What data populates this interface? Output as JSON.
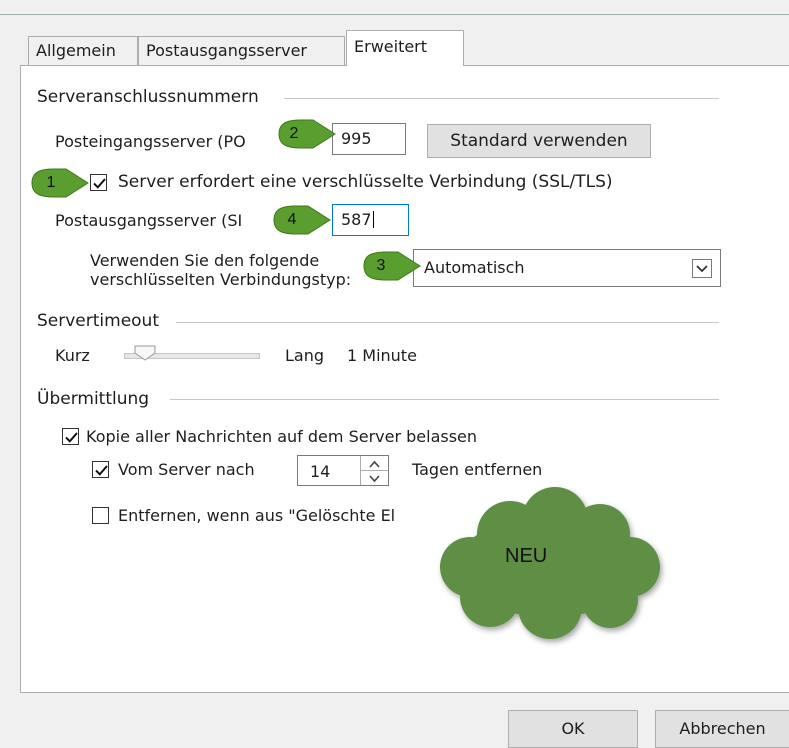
{
  "tabs": [
    {
      "label": "Allgemein",
      "active": false
    },
    {
      "label": "Postausgangsserver",
      "active": false
    },
    {
      "label": "Erweitert",
      "active": true
    }
  ],
  "server_ports": {
    "group_label": "Serveranschlussnummern",
    "incoming_label": "Posteingangsserver (PO",
    "incoming_port": "995",
    "default_button": "Standard verwenden",
    "ssl_checkbox_label": "Server erfordert eine verschlüsselte Verbindung (SSL/TLS)",
    "ssl_checked": true,
    "outgoing_label": "Postausgangsserver (SI",
    "outgoing_port": "587",
    "encryption_label_line1": "Verwenden Sie den folgende",
    "encryption_label_line2": "verschlüsselten Verbindungstyp:",
    "encryption_value": "Automatisch"
  },
  "server_timeout": {
    "group_label": "Servertimeout",
    "short_label": "Kurz",
    "long_label": "Lang",
    "value_text": "1 Minute"
  },
  "delivery": {
    "group_label": "Übermittlung",
    "keep_copy_label": "Kopie aller Nachrichten auf dem Server belassen",
    "keep_copy_checked": true,
    "remove_after_prefix": "Vom Server nach",
    "remove_after_days": "14",
    "remove_after_suffix": "Tagen entfernen",
    "remove_after_checked": true,
    "remove_deleted_label": "Entfernen, wenn aus \"Gelöschte El",
    "remove_deleted_checked": false
  },
  "annotations": {
    "badges": [
      "1",
      "2",
      "3",
      "4"
    ],
    "cloud_text": "NEU",
    "badge_color": "#5a9e2f",
    "cloud_color": "#5f8f45"
  },
  "footer": {
    "ok_label": "OK",
    "cancel_label": "Abbrechen"
  }
}
